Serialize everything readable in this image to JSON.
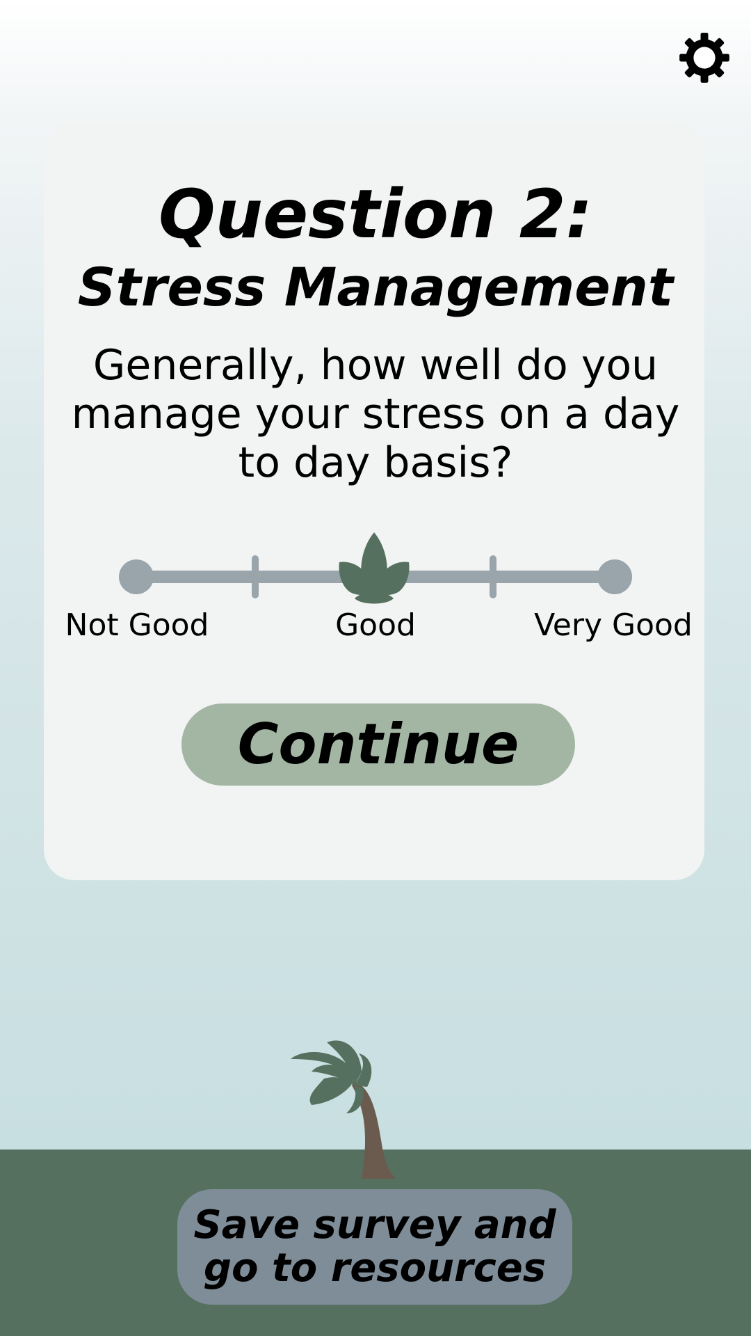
{
  "header": {
    "settings_icon": "gear-icon"
  },
  "question": {
    "title": "Question 2:",
    "subtitle": "Stress Management",
    "prompt": "Generally, how well do you manage your stress on a day to day basis?"
  },
  "slider": {
    "labels": {
      "low": "Not Good",
      "mid": "Good",
      "high": "Very Good"
    },
    "steps": 5,
    "selected_step": 3,
    "selected_label": "Good",
    "thumb_icon": "leaf-icon",
    "track_color": "#99a4ab",
    "thumb_color": "#55705e"
  },
  "actions": {
    "continue_label": "Continue",
    "resources_label_line1": "Save survey and",
    "resources_label_line2": "go to resources"
  },
  "colors": {
    "card": "#f2f3f3",
    "continue_button": "#a2b6a3",
    "resources_button": "#7e8d98",
    "ground": "#55705e",
    "tree_trunk": "#6b5b4f",
    "tree_leaves": "#55705e"
  },
  "decor": {
    "tree_icon": "palm-tree-icon"
  }
}
